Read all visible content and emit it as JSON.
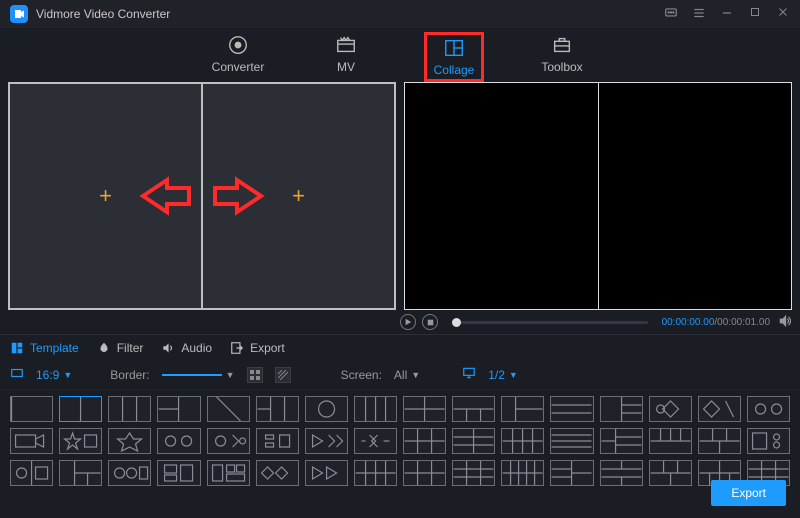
{
  "app": {
    "title": "Vidmore Video Converter"
  },
  "window_controls": {
    "feedback": "feedback-icon",
    "menu": "menu-icon",
    "minimize": "minimize-icon",
    "maximize": "maximize-icon",
    "close": "close-icon"
  },
  "main_tabs": [
    {
      "id": "converter",
      "label": "Converter",
      "icon": "converter-icon",
      "active": false
    },
    {
      "id": "mv",
      "label": "MV",
      "icon": "mv-icon",
      "active": false
    },
    {
      "id": "collage",
      "label": "Collage",
      "icon": "collage-icon",
      "active": true,
      "highlighted": true
    },
    {
      "id": "toolbox",
      "label": "Toolbox",
      "icon": "toolbox-icon",
      "active": false
    }
  ],
  "collage_editor": {
    "slots": [
      {
        "id": "slot-1",
        "state": "empty"
      },
      {
        "id": "slot-2",
        "state": "empty"
      }
    ]
  },
  "player": {
    "current_time": "00:00:00.00",
    "total_time": "00:00:01.00"
  },
  "sub_tabs": [
    {
      "id": "template",
      "label": "Template",
      "icon": "template-tab-icon",
      "active": true
    },
    {
      "id": "filter",
      "label": "Filter",
      "icon": "filter-tab-icon",
      "active": false
    },
    {
      "id": "audio",
      "label": "Audio",
      "icon": "audio-tab-icon",
      "active": false
    },
    {
      "id": "export",
      "label": "Export",
      "icon": "export-tab-icon",
      "active": false
    }
  ],
  "controls": {
    "aspect_label": "16:9",
    "border_label": "Border:",
    "screen_label": "Screen:",
    "screen_value": "All",
    "page_label": "1/2"
  },
  "templates": {
    "rows": 3,
    "cols": 16,
    "active_index": 1
  },
  "footer": {
    "export_label": "Export"
  }
}
